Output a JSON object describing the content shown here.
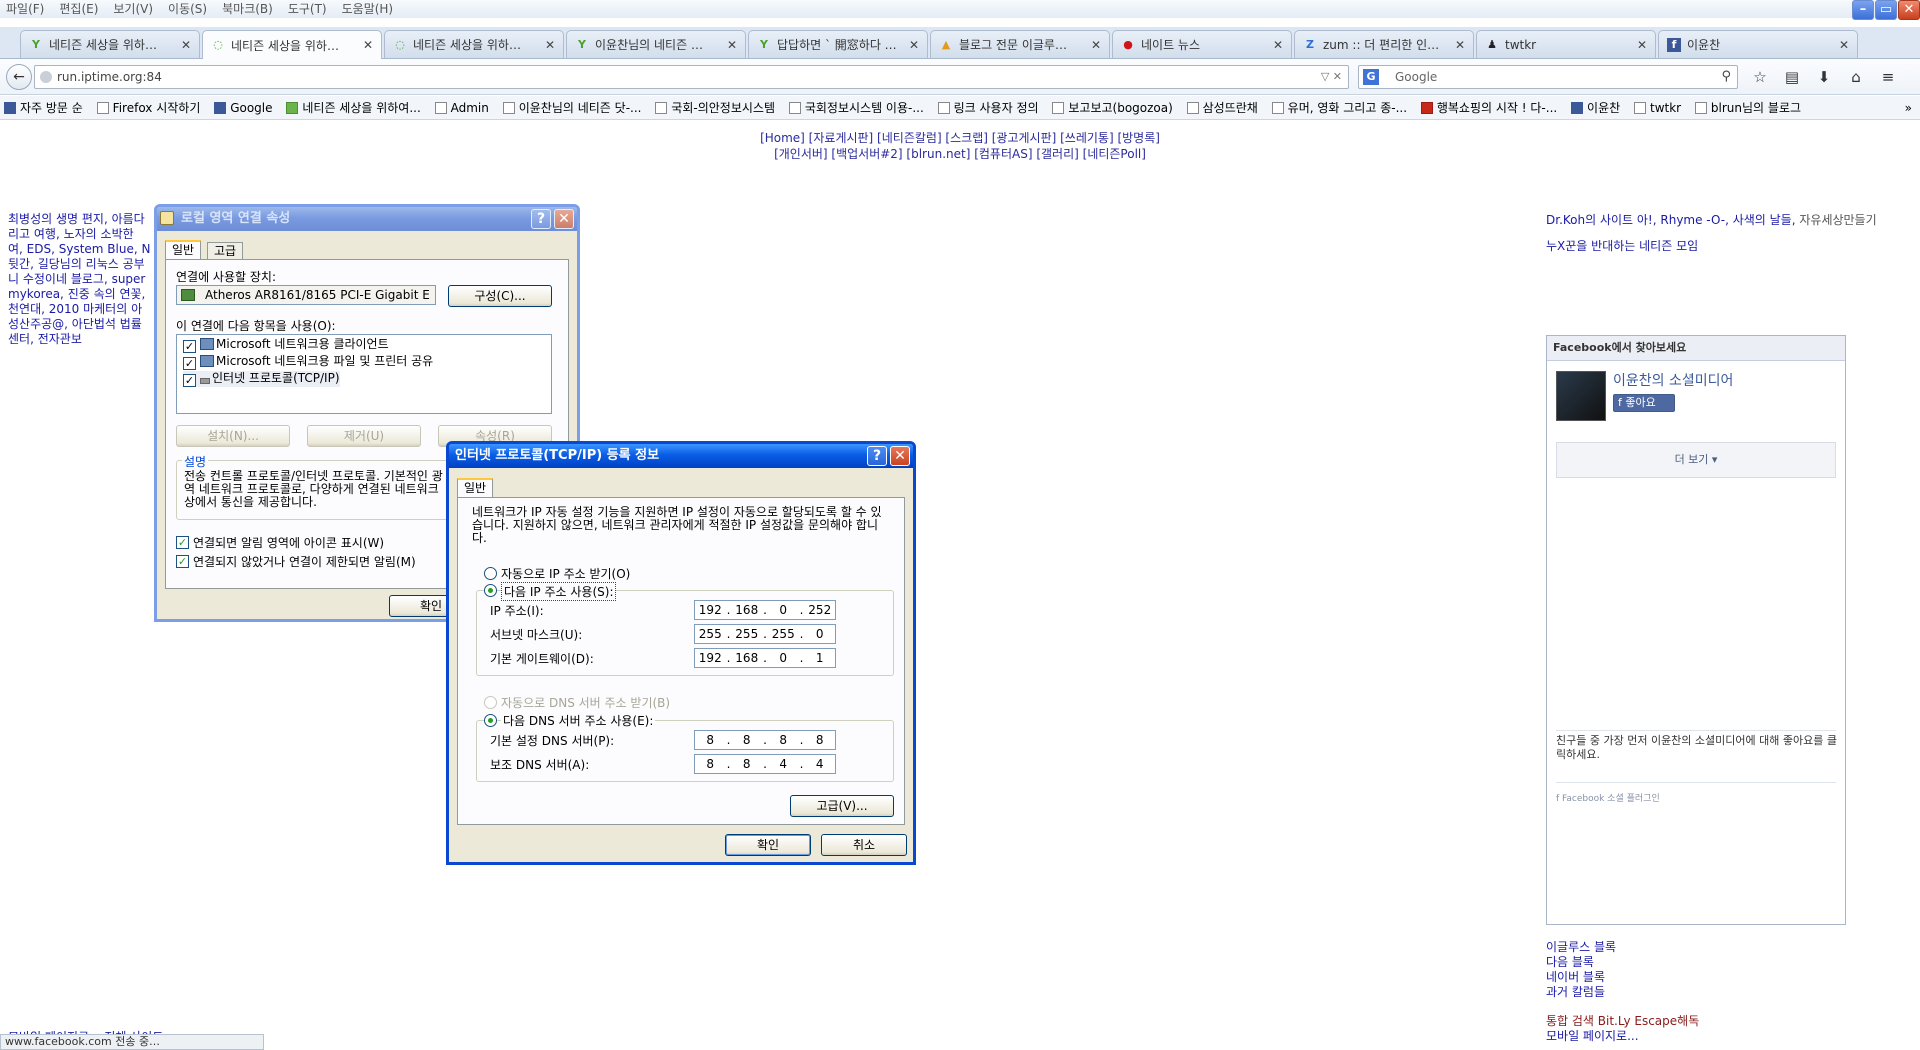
{
  "menubar": {
    "items": [
      "파일(F)",
      "편집(E)",
      "보기(V)",
      "이동(S)",
      "북마크(B)",
      "도구(T)",
      "도움말(H)"
    ]
  },
  "window_controls": {
    "minimize": "–",
    "restore": "▭",
    "close": "✕"
  },
  "tabs": [
    {
      "label": "네티즌 세상을 위하…",
      "icon": "Y"
    },
    {
      "label": "네티즌 세상을 위하…",
      "icon": "◌"
    },
    {
      "label": "네티즌 세상을 위하…",
      "icon": "◌"
    },
    {
      "label": "이윤찬님의 네티즌 …",
      "icon": "Y"
    },
    {
      "label": "답답하면 ` 開窓하다 …",
      "icon": "Y"
    },
    {
      "label": "블로그 전문 이글루…",
      "icon": "▲"
    },
    {
      "label": "네이트 뉴스",
      "icon": "●"
    },
    {
      "label": "zum :: 더 편리한 인…",
      "icon": "Z"
    },
    {
      "label": "twtkr",
      "icon": "♟"
    },
    {
      "label": "이윤찬",
      "icon": "f"
    }
  ],
  "tab_close": "✕",
  "newtab": "+",
  "nav": {
    "back": "←",
    "url": "run.iptime.org:84",
    "url_controls": "▽ ✕",
    "search_engine": "G",
    "search_placeholder": "Google",
    "search_icon": "⚲",
    "tool_icons": [
      "☆",
      "▤",
      "⬇",
      "⌂",
      "≡"
    ]
  },
  "bookmarks": [
    {
      "label": "자주 방문 순",
      "icon": "blue"
    },
    {
      "label": "Firefox 시작하기",
      "icon": ""
    },
    {
      "label": "Google",
      "icon": "blue"
    },
    {
      "label": "네티즌 세상을 위하여...",
      "icon": "green"
    },
    {
      "label": "Admin",
      "icon": ""
    },
    {
      "label": "이윤찬님의 네티즌 닷-...",
      "icon": ""
    },
    {
      "label": "국회-의안정보시스템",
      "icon": ""
    },
    {
      "label": "국회정보시스템 이용-...",
      "icon": ""
    },
    {
      "label": "링크 사용자 정의",
      "icon": ""
    },
    {
      "label": "보고보고(bogozoa)",
      "icon": ""
    },
    {
      "label": "삼성뜨란채",
      "icon": ""
    },
    {
      "label": "유머, 영화 그리고 종-...",
      "icon": ""
    },
    {
      "label": "행복쇼핑의 시작 ! 다-...",
      "icon": "red"
    },
    {
      "label": "이윤찬",
      "icon": "blue"
    },
    {
      "label": "twtkr",
      "icon": ""
    },
    {
      "label": "blrun님의 블로그",
      "icon": ""
    }
  ],
  "bookmarks_more": "»",
  "page": {
    "nav_line1": "[Home] [자료게시판] [네티즌칼럼] [스크랩] [광고게시판] [쓰레기통] [방명록]",
    "nav_line2": "[개인서버] [백업서버#2] [blrun.net] [컴퓨터AS] [갤러리] [네티즌Poll]",
    "left_links": [
      "최병성의 생명 편지, 아름다",
      "리고 여행, 노자의 소박한 ​",
      "여, EDS, System Blue, N",
      "뒷간, 길당님의 리눅스 공부",
      "니 수정이네 블로그, super",
      "mykorea, 진중 속의 연꽃,",
      "천연대, 2010 마케터의 아",
      "성산주공@, 아단법석 법률",
      "센터, 전자관보"
    ],
    "right_line1": "Dr.Koh의 사이트 아!, Rhyme -O-, 사색의 날들, ",
    "right_line1_gray": "자유세상만들기",
    "right_line2": "누X꾼을 반대하는 네티즌 모임",
    "fb": {
      "header": "Facebook에서 찾아보세요",
      "page_title": "이윤찬의 소셜미디어",
      "like": "f 좋아요",
      "more": "더 보기 ▾",
      "footer": "친구들 중 가장 먼저 이윤찬의 소셜미디어에 대해 좋아요를 클릭하세요.",
      "plugin": "f  Facebook 소셜 플러그인"
    },
    "bottom_links": [
      "이글루스 블록",
      "다음 블록",
      "네이버 블록",
      "과거 칼럼들"
    ],
    "bottom_red": "통합 검색 Bit.Ly Escape해독",
    "bottom_last": "모바일 페이지로...",
    "cutoff": "모바일 페이지로... 전체 사이트",
    "status": "www.facebook.com 전송 중…"
  },
  "dialog1": {
    "title": "로컬 영역 연결 속성",
    "help": "?",
    "close": "✕",
    "tab_general": "일반",
    "tab_advanced": "고급",
    "device_label": "연결에 사용할 장치:",
    "device": "Atheros AR8161/8165 PCI-E Gigabit E",
    "configure": "구성(C)...",
    "items_label": "이 연결에 다음 항목을 사용(O):",
    "items": [
      "Microsoft 네트워크용 클라이언트",
      "Microsoft 네트워크용 파일 및 프린터 공유",
      "인터넷 프로토콜(TCP/IP)"
    ],
    "install": "설치(N)...",
    "remove": "제거(U)",
    "properties": "속성(R)",
    "desc_title": "설명",
    "desc": "전송 컨트롤 프로토콜/인터넷 프로토콜. 기본적인 광역 네트워크 프로토콜로, 다양하게 연결된 네트워크상에서 통신을 제공합니다.",
    "check1": "연결되면 알림 영역에 아이콘 표시(W)",
    "check2": "연결되지 않았거나 연결이 제한되면 알림(M)",
    "ok": "확인"
  },
  "dialog2": {
    "title": "인터넷 프로토콜(TCP/IP) 등록 정보",
    "help": "?",
    "close": "✕",
    "tab": "일반",
    "intro": "네트워크가 IP 자동 설정 기능을 지원하면 IP 설정이 자동으로 할당되도록 할 수 있습니다. 지원하지 않으면, 네트워크 관리자에게 적절한 IP 설정값을 문의해야 합니다.",
    "auto_ip": "자동으로 IP 주소 받기(O)",
    "manual_ip": "다음 IP 주소 사용(S):",
    "ip_label": "IP 주소(I):",
    "ip": [
      "192",
      "168",
      "0",
      "252"
    ],
    "mask_label": "서브넷 마스크(U):",
    "mask": [
      "255",
      "255",
      "255",
      "0"
    ],
    "gw_label": "기본 게이트웨이(D):",
    "gw": [
      "192",
      "168",
      "0",
      "1"
    ],
    "auto_dns": "자동으로 DNS 서버 주소 받기(B)",
    "manual_dns": "다음 DNS 서버 주소 사용(E):",
    "dns1_label": "기본 설정 DNS 서버(P):",
    "dns1": [
      "8",
      "8",
      "8",
      "8"
    ],
    "dns2_label": "보조 DNS 서버(A):",
    "dns2": [
      "8",
      "8",
      "4",
      "4"
    ],
    "advanced": "고급(V)...",
    "ok": "확인",
    "cancel": "취소"
  }
}
